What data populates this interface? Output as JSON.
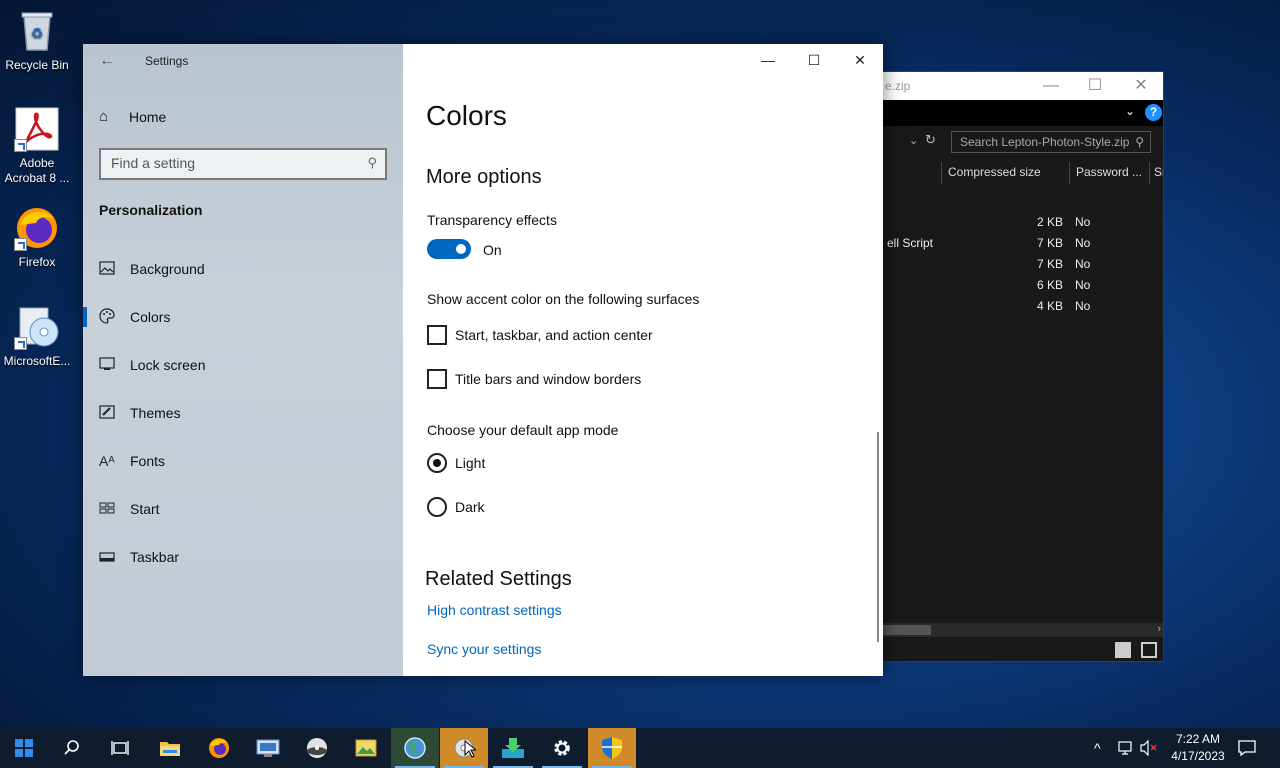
{
  "desktop": {
    "icons": [
      {
        "label": "Recycle Bin"
      },
      {
        "label": "Adobe Acrobat 8 ..."
      },
      {
        "label": "Firefox"
      },
      {
        "label": "MicrosoftE..."
      }
    ]
  },
  "zip_window": {
    "title": "e.zip",
    "search_placeholder": "Search Lepton-Photon-Style.zip",
    "columns": [
      "Compressed size",
      "Password ...",
      "Si"
    ],
    "rows": [
      {
        "name": "",
        "size": "2 KB",
        "password": "No"
      },
      {
        "name": "ell Script",
        "size": "7 KB",
        "password": "No"
      },
      {
        "name": "",
        "size": "7 KB",
        "password": "No"
      },
      {
        "name": "",
        "size": "6 KB",
        "password": "No"
      },
      {
        "name": "",
        "size": "4 KB",
        "password": "No"
      }
    ]
  },
  "settings": {
    "app_title": "Settings",
    "home": "Home",
    "search_placeholder": "Find a setting",
    "section": "Personalization",
    "nav": [
      {
        "label": "Background",
        "icon": "picture-icon"
      },
      {
        "label": "Colors",
        "icon": "palette-icon"
      },
      {
        "label": "Lock screen",
        "icon": "lock-screen-icon"
      },
      {
        "label": "Themes",
        "icon": "brush-icon"
      },
      {
        "label": "Fonts",
        "icon": "font-icon"
      },
      {
        "label": "Start",
        "icon": "start-icon"
      },
      {
        "label": "Taskbar",
        "icon": "taskbar-icon"
      }
    ],
    "page_title": "Colors",
    "more_options": "More options",
    "transparency_label": "Transparency effects",
    "transparency_state": "On",
    "accent_label": "Show accent color on the following surfaces",
    "accent_start": "Start, taskbar, and action center",
    "accent_titlebars": "Title bars and window borders",
    "mode_label": "Choose your default app mode",
    "mode_light": "Light",
    "mode_dark": "Dark",
    "related": "Related Settings",
    "link_contrast": "High contrast settings",
    "link_sync": "Sync your settings",
    "accent_color": "#0067c0"
  },
  "taskbar": {
    "time": "7:22 AM",
    "date": "4/17/2023"
  }
}
